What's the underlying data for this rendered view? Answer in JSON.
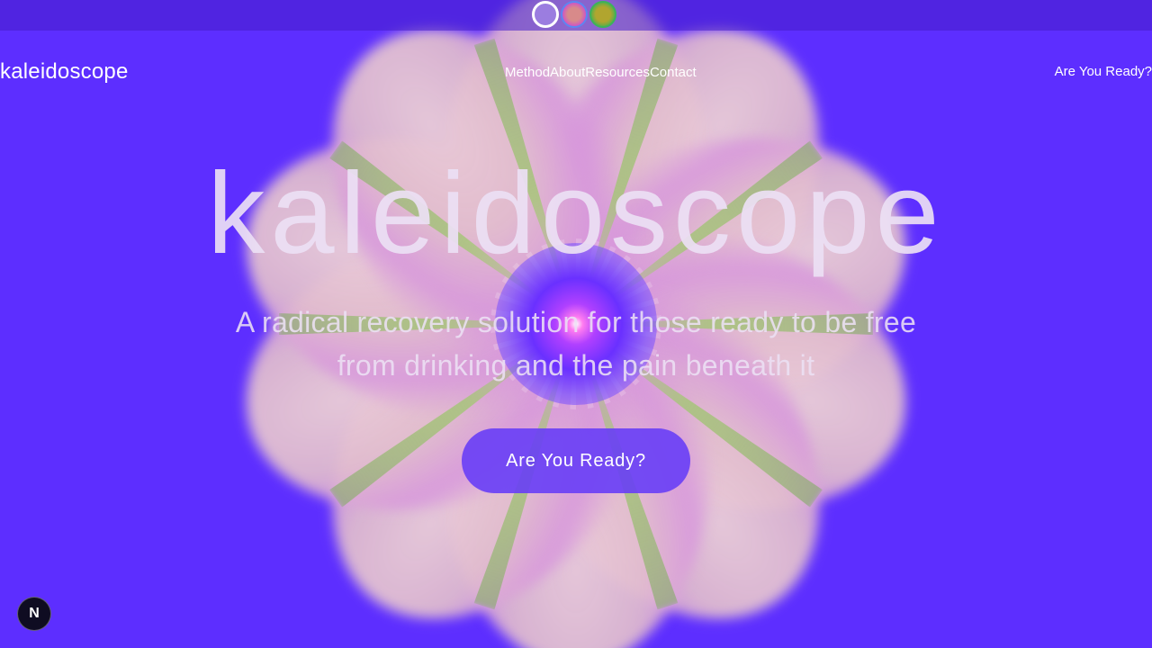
{
  "colors": {
    "background": "#5d2eff",
    "button": "#683ef6",
    "text": "#ffffff"
  },
  "theme_swatches": [
    {
      "name": "violet"
    },
    {
      "name": "pink-blue"
    },
    {
      "name": "olive-green"
    }
  ],
  "header": {
    "brand": "kaleidoscope",
    "nav": [
      "Method",
      "About",
      "Resources",
      "Contact"
    ],
    "cta": "Are You Ready?"
  },
  "hero": {
    "title": "kaleidoscope",
    "subtitle": "A radical recovery solution for those ready to be free from drinking and the pain beneath it",
    "button": "Are You Ready?"
  },
  "badge": {
    "letter": "N",
    "icon": "n-logo-icon"
  }
}
